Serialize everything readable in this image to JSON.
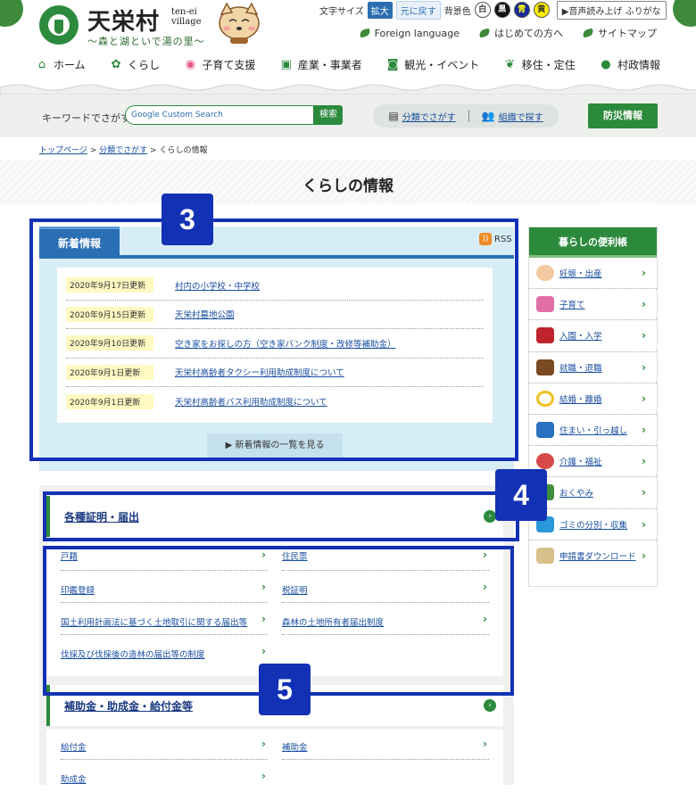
{
  "header": {
    "logo_title": "天栄村",
    "logo_roman": "ten-ei village",
    "logo_tagline": "～森と湖といで湯の里～",
    "font_size_label": "文字サイズ",
    "enlarge": "拡大",
    "reset": "元に戻す",
    "bg_color_label": "背景色",
    "bg_colors": [
      {
        "label": "白",
        "bg": "#ffffff",
        "fg": "#333333"
      },
      {
        "label": "黒",
        "bg": "#111111",
        "fg": "#ffffff"
      },
      {
        "label": "青",
        "bg": "#1a2a9a",
        "fg": "#ffff00"
      },
      {
        "label": "黄",
        "bg": "#ffee00",
        "fg": "#333333"
      }
    ],
    "voice": "▶音声読み上げ ふりがな",
    "top_links": [
      "Foreign language",
      "はじめての方へ",
      "サイトマップ"
    ]
  },
  "gnav": [
    {
      "label": "ホーム",
      "icon": "home-icon",
      "glyph": "⌂"
    },
    {
      "label": "くらし",
      "icon": "gear-icon",
      "glyph": "✿"
    },
    {
      "label": "子育て支援",
      "icon": "baby-icon",
      "glyph": "◉"
    },
    {
      "label": "産業・事業者",
      "icon": "briefcase-icon",
      "glyph": "▣"
    },
    {
      "label": "観光・イベント",
      "icon": "camera-icon",
      "glyph": "◙"
    },
    {
      "label": "移住・定住",
      "icon": "sprout-icon",
      "glyph": "❦"
    },
    {
      "label": "村政情報",
      "icon": "chat-icon",
      "glyph": "●"
    }
  ],
  "search": {
    "label": "キーワードでさがす",
    "placeholder": "Google Custom Search",
    "button": "検索",
    "by_category": "分類でさがす",
    "by_org": "組織で探す",
    "disaster": "防災情報"
  },
  "breadcrumb": {
    "home": "トップページ",
    "sep": ">",
    "category": "分類でさがす",
    "current": "くらしの情報"
  },
  "page_title": "くらしの情報",
  "news": {
    "tab": "新着情報",
    "rss": "RSS",
    "items": [
      {
        "date": "2020年9月17日更新",
        "title": "村内の小学校・中学校"
      },
      {
        "date": "2020年9月15日更新",
        "title": "天栄村墓地公園"
      },
      {
        "date": "2020年9月10日更新",
        "title": "空き家をお探しの方（空き家バンク制度・改修等補助金）"
      },
      {
        "date": "2020年9月1日更新",
        "title": "天栄村高齢者タクシー利用助成制度について"
      },
      {
        "date": "2020年9月1日更新",
        "title": "天栄村高齢者バス利用助成制度について"
      }
    ],
    "more": "▶ 新着情報の一覧を見る"
  },
  "categories": [
    {
      "title": "各種証明・届出",
      "links": [
        "戸籍",
        "住民票",
        "印鑑登録",
        "税証明",
        "国土利用計画法に基づく土地取引に関する届出等",
        "森林の土地所有者届出制度",
        "伐採及び伐採後の造林の届出等の制度"
      ]
    },
    {
      "title": "補助金・助成金・給付金等",
      "links": [
        "給付金",
        "補助金",
        "助成金"
      ]
    }
  ],
  "sidebar": {
    "title": "暮らしの便利帳",
    "items": [
      {
        "label": "妊娠・出産",
        "icon": "baby-face-icon",
        "color": "#f3c9a0"
      },
      {
        "label": "子育て",
        "icon": "blocks-icon",
        "color": "#e06fa8"
      },
      {
        "label": "入園・入学",
        "icon": "school-bag-icon",
        "color": "#c0242c"
      },
      {
        "label": "就職・退職",
        "icon": "bag-icon",
        "color": "#7a4a22"
      },
      {
        "label": "結婚・離婚",
        "icon": "ring-icon",
        "color": "#f0c020"
      },
      {
        "label": "住まい・引っ越し",
        "icon": "truck-icon",
        "color": "#2a70c0"
      },
      {
        "label": "介護・福祉",
        "icon": "wheelchair-icon",
        "color": "#d84a4a"
      },
      {
        "label": "おくやみ",
        "icon": "flower-icon",
        "color": "#3e8e3e"
      },
      {
        "label": "ゴミの分別・収集",
        "icon": "trash-icon",
        "color": "#2a98d8"
      },
      {
        "label": "申請書ダウンロード",
        "icon": "document-icon",
        "color": "#d8c08a"
      }
    ]
  },
  "highlights": [
    "3",
    "4",
    "5"
  ],
  "colors": {
    "brand_green": "#2c8a3c",
    "news_blue": "#2a6fb4",
    "highlight_blue": "#1231b5"
  }
}
